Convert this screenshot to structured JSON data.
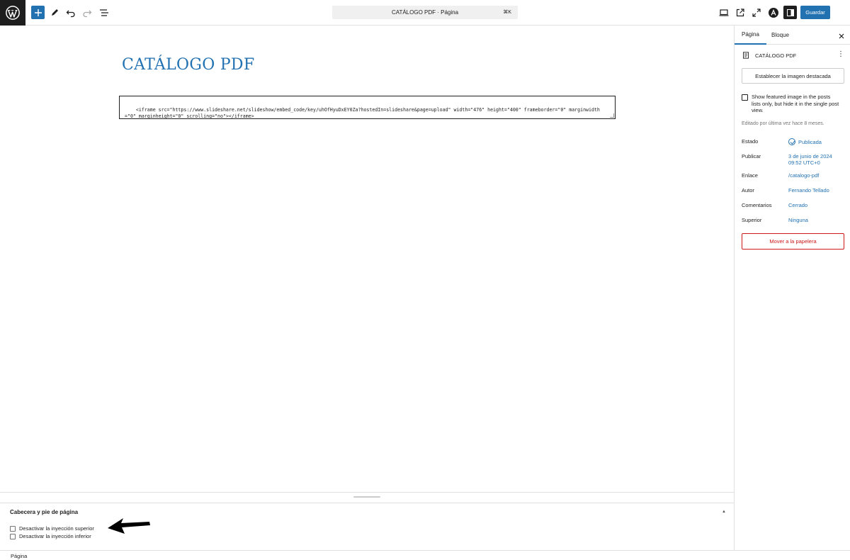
{
  "topbar": {
    "command_bar_label": "CATÁLOGO PDF · Página",
    "command_shortcut": "⌘K",
    "save_label": "Guardar"
  },
  "editor": {
    "title": "CATÁLOGO PDF",
    "html_block_code": "<iframe src=\"https://www.slideshare.net/slideshow/embed_code/key/uhOfHyuDxEY0Za?hostedIn=slideshare&page=upload\" width=\"476\" height=\"400\" frameborder=\"0\" marginwidth=\"0\" marginheight=\"0\" scrolling=\"no\"></iframe>"
  },
  "metabox": {
    "title": "Cabecera y pie de página",
    "options": [
      "Desactivar la inyección superior",
      "Desactivar la inyección inferior"
    ]
  },
  "statusbar": {
    "label": "Página"
  },
  "sidebar": {
    "tabs": [
      "Página",
      "Bloque"
    ],
    "doc_title": "CATÁLOGO PDF",
    "featured_button": "Establecer la imagen destacada",
    "featured_checkbox": "Show featured image in the posts lists only, but hide it in the single post view.",
    "last_edited": "Editado por última vez hace 8 meses.",
    "rows": [
      {
        "label": "Estado",
        "value": "Publicada"
      },
      {
        "label": "Publicar",
        "value": "3 de junio de 2024 09:52 UTC+0"
      },
      {
        "label": "Enlace",
        "value": "/catalogo-pdf"
      },
      {
        "label": "Autor",
        "value": "Fernando Tellado"
      },
      {
        "label": "Comentarios",
        "value": "Cerrado"
      },
      {
        "label": "Superior",
        "value": "Ninguna"
      }
    ],
    "trash_button": "Mover a la papelera"
  },
  "colors": {
    "accent": "#2271b1",
    "danger": "#cc1818",
    "dark": "#1e1e1e"
  }
}
